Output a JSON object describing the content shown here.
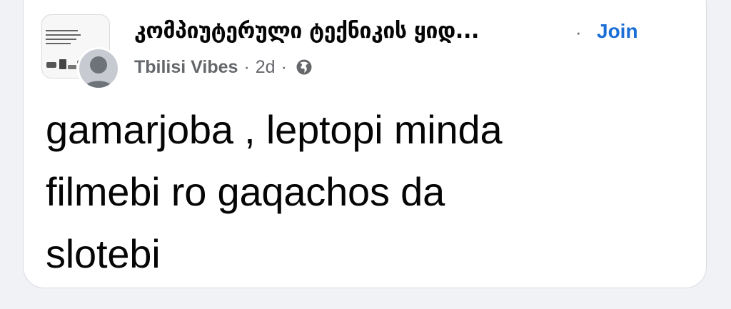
{
  "post": {
    "group": {
      "name": "კომპიუტერული ტექნიკის ყიდ...",
      "join_label": "Join",
      "separator": "·",
      "thumbnail_icon": "group-cover-image"
    },
    "author": "Tbilisi Vibes",
    "time": "2d",
    "separator": "·",
    "privacy_icon": "globe-icon",
    "text_lines": [
      "gamarjoba , leptopi minda",
      "filmebi ro gaqachos da",
      "slotebi"
    ]
  },
  "colors": {
    "link": "#1b6ed6",
    "secondary_text": "#65676b",
    "primary_text": "#050505",
    "background": "#f0f2f5"
  }
}
